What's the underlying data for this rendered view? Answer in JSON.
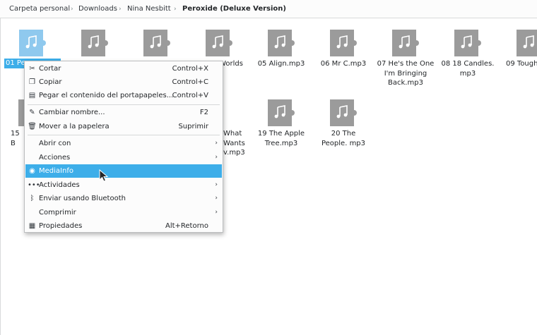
{
  "breadcrumb": {
    "items": [
      "Carpeta personal",
      "Downloads",
      "Nina Nesbitt",
      "Peroxide (Deluxe Version)"
    ],
    "separator": "›"
  },
  "files": [
    {
      "label": "01 Pe"
    },
    {
      "label": ""
    },
    {
      "label": ""
    },
    {
      "label": "Worlds"
    },
    {
      "label": "05 Align.mp3"
    },
    {
      "label": "06 Mr C.mp3"
    },
    {
      "label": "07 He's the One I'm Bringing Back.mp3"
    },
    {
      "label": "08 18 Candles. mp3"
    },
    {
      "label": "09 Tough"
    },
    {
      "label": "15 B Ey"
    },
    {
      "label": "What Wants v.mp3"
    },
    {
      "label": "19 The Apple Tree.mp3"
    },
    {
      "label": "20 The People. mp3"
    }
  ],
  "context_menu": {
    "cut": {
      "label": "Cortar",
      "shortcut": "Control+X",
      "icon": "scissors-icon"
    },
    "copy": {
      "label": "Copiar",
      "shortcut": "Control+C",
      "icon": "copy-icon"
    },
    "paste": {
      "label": "Pegar el contenido del portapapeles...",
      "shortcut": "Control+V",
      "icon": "clipboard-icon"
    },
    "rename": {
      "label": "Cambiar nombre...",
      "shortcut": "F2",
      "icon": "pencil-icon"
    },
    "trash": {
      "label": "Mover a la papelera",
      "shortcut": "Suprimir",
      "icon": "trash-icon"
    },
    "open_with": {
      "label": "Abrir con"
    },
    "actions": {
      "label": "Acciones"
    },
    "mediainfo": {
      "label": "MediaInfo",
      "icon": "speaker-icon"
    },
    "activities": {
      "label": "Actividades",
      "icon": "dots-icon"
    },
    "bluetooth": {
      "label": "Enviar usando Bluetooth",
      "icon": "bluetooth-icon"
    },
    "compress": {
      "label": "Comprimir"
    },
    "properties": {
      "label": "Propiedades",
      "shortcut": "Alt+Retorno",
      "icon": "properties-icon"
    }
  },
  "colors": {
    "accent": "#3daee9",
    "icon_gray": "#9b9b9b"
  }
}
